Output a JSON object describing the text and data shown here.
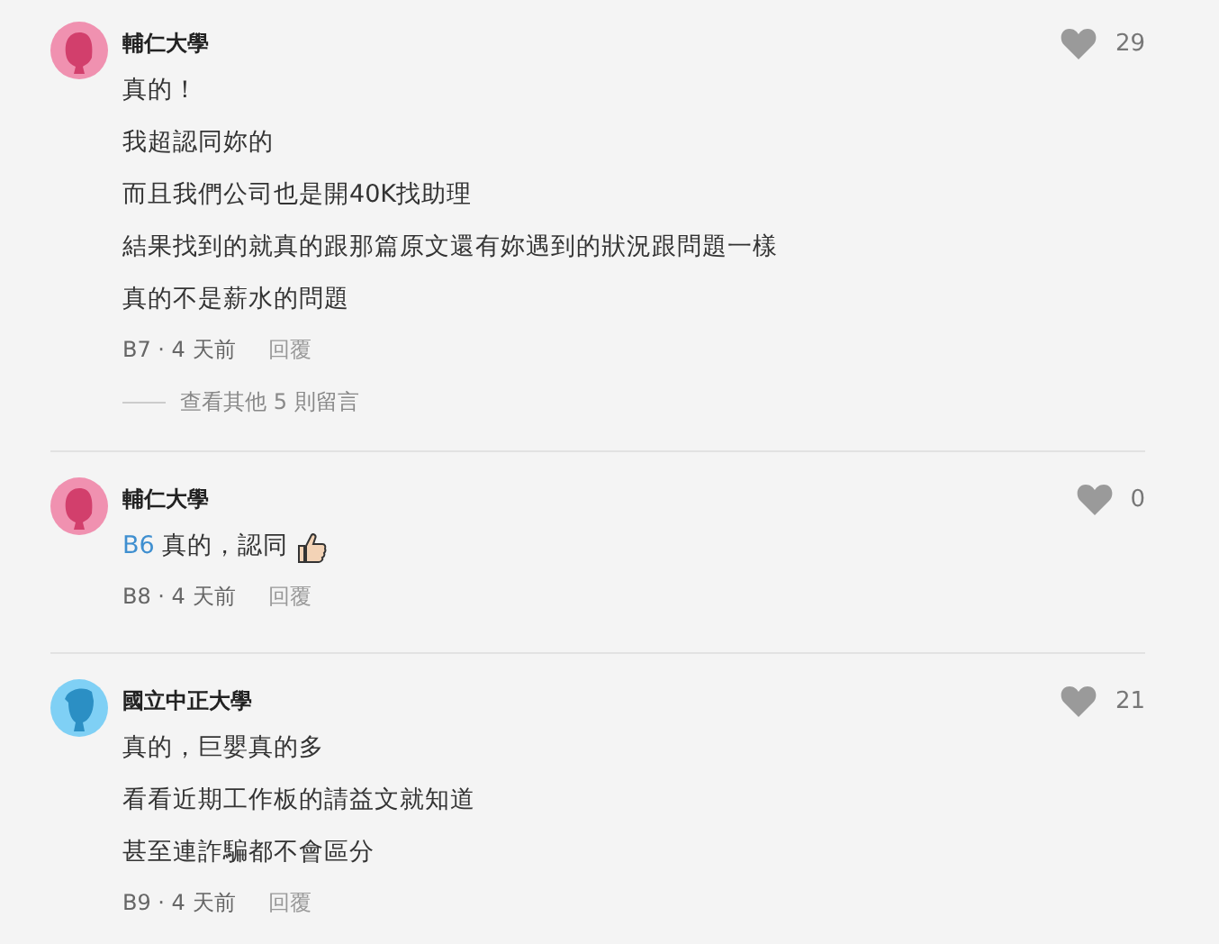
{
  "comments": [
    {
      "author": "輔仁大學",
      "avatar": {
        "kind": "female"
      },
      "likes": "29",
      "body": [
        "真的！",
        "我超認同妳的",
        "而且我們公司也是開40K找助理",
        "結果找到的就真的跟那篇原文還有妳遇到的狀況跟問題一樣",
        "真的不是薪水的問題"
      ],
      "meta": "B7 · 4 天前",
      "reply": "回覆",
      "more_replies": "查看其他 5 則留言"
    },
    {
      "author": "輔仁大學",
      "avatar": {
        "kind": "female"
      },
      "likes": "0",
      "mention": "B6",
      "body": [
        "真的，認同"
      ],
      "ends_with_icon": true,
      "meta": "B8 · 4 天前",
      "reply": "回覆"
    },
    {
      "author": "國立中正大學",
      "avatar": {
        "kind": "male"
      },
      "likes": "21",
      "body": [
        "真的，巨嬰真的多",
        "看看近期工作板的請益文就知道",
        "甚至連詐騙都不會區分"
      ],
      "meta": "B9 · 4 天前",
      "reply": "回覆"
    }
  ]
}
